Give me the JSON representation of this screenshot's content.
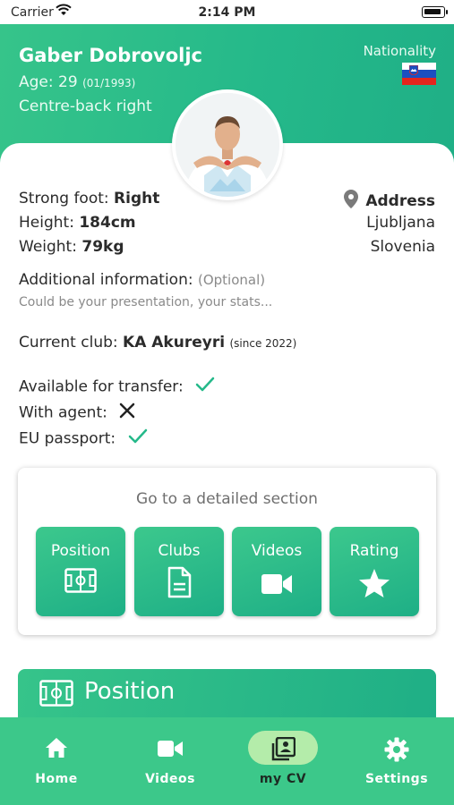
{
  "status_bar": {
    "carrier": "Carrier",
    "time": "2:14 PM"
  },
  "header": {
    "name": "Gaber Dobrovoljc",
    "age_label": "Age: 29",
    "birth": "(01/1993)",
    "position": "Centre-back right",
    "nationality_label": "Nationality"
  },
  "flag_colors": [
    "#ffffff",
    "#1b4fc0",
    "#e3251d"
  ],
  "details": {
    "strong_foot_label": "Strong foot:",
    "strong_foot_value": "Right",
    "height_label": "Height:",
    "height_value": "184cm",
    "weight_label": "Weight:",
    "weight_value": "79kg",
    "address_label": "Address",
    "city": "Ljubljana",
    "country": "Slovenia",
    "additional_label": "Additional information:",
    "additional_optional": "(Optional)",
    "additional_placeholder": "Could be your presentation, your stats...",
    "club_label": "Current club:",
    "club_value": "KA Akureyri",
    "club_since": "(since 2022)",
    "transfer_label": "Available for transfer:",
    "transfer_value": "check",
    "agent_label": "With agent:",
    "agent_value": "cross",
    "passport_label": "EU passport:",
    "passport_value": "check"
  },
  "sections": {
    "title": "Go to a detailed section",
    "tiles": [
      {
        "label": "Position",
        "icon": "pitch-icon"
      },
      {
        "label": "Clubs",
        "icon": "document-icon"
      },
      {
        "label": "Videos",
        "icon": "video-camera-icon"
      },
      {
        "label": "Rating",
        "icon": "star-icon"
      }
    ]
  },
  "position_section": {
    "title": "Position",
    "icon": "pitch-icon"
  },
  "tabbar": {
    "items": [
      {
        "label": "Home",
        "icon": "home-icon"
      },
      {
        "label": "Videos",
        "icon": "video-camera-icon"
      },
      {
        "label": "my CV",
        "icon": "cv-icon",
        "active": true
      },
      {
        "label": "Settings",
        "icon": "gear-icon"
      }
    ]
  },
  "colors": {
    "brand_green": "#25b98a",
    "tab_bar": "#3cc88a",
    "active_pill": "#b4ecaa",
    "check_green": "#25b98a"
  }
}
